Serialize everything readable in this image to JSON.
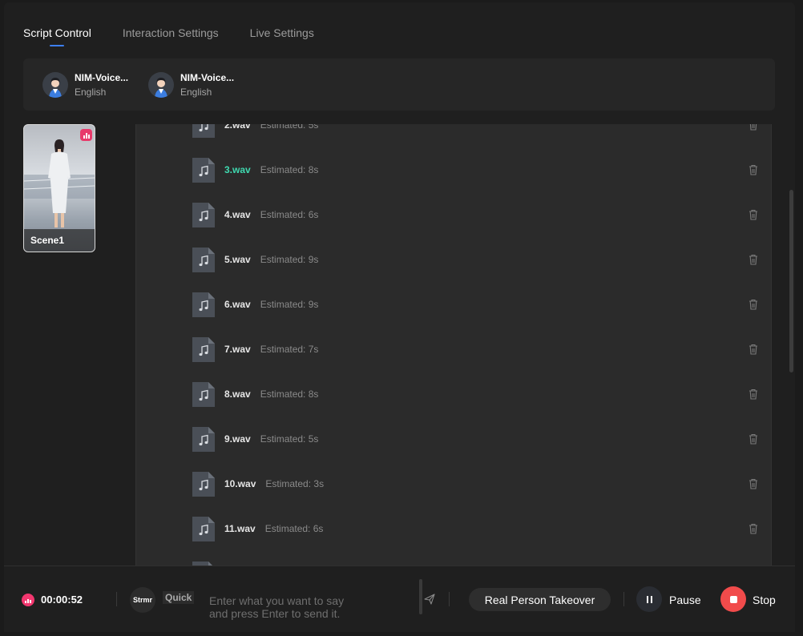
{
  "tabs": [
    {
      "label": "Script Control",
      "active": true
    },
    {
      "label": "Interaction Settings",
      "active": false
    },
    {
      "label": "Live Settings",
      "active": false
    }
  ],
  "voices": [
    {
      "name": "NIM-Voice...",
      "language": "English"
    },
    {
      "name": "NIM-Voice...",
      "language": "English"
    }
  ],
  "scene": {
    "label": "Scene1"
  },
  "scripts": [
    {
      "name": "2.wav",
      "estimate": "Estimated: 5s",
      "active": false
    },
    {
      "name": "3.wav",
      "estimate": "Estimated: 8s",
      "active": true
    },
    {
      "name": "4.wav",
      "estimate": "Estimated: 6s",
      "active": false
    },
    {
      "name": "5.wav",
      "estimate": "Estimated: 9s",
      "active": false
    },
    {
      "name": "6.wav",
      "estimate": "Estimated: 9s",
      "active": false
    },
    {
      "name": "7.wav",
      "estimate": "Estimated: 7s",
      "active": false
    },
    {
      "name": "8.wav",
      "estimate": "Estimated: 8s",
      "active": false
    },
    {
      "name": "9.wav",
      "estimate": "Estimated: 5s",
      "active": false
    },
    {
      "name": "10.wav",
      "estimate": "Estimated: 3s",
      "active": false
    },
    {
      "name": "11.wav",
      "estimate": "Estimated: 6s",
      "active": false
    }
  ],
  "bottom": {
    "timer": "00:00:52",
    "streamer_label": "Strmr",
    "quick_label": "Quick",
    "input_placeholder": "Enter what you want to say and press Enter to send it.",
    "takeover_label": "Real Person Takeover",
    "pause_label": "Pause",
    "stop_label": "Stop"
  },
  "colors": {
    "accent_blue": "#3d7ff5",
    "active_file": "#3fd9b0",
    "stop_red": "#f14b4b",
    "live_pink": "#f2376f"
  }
}
